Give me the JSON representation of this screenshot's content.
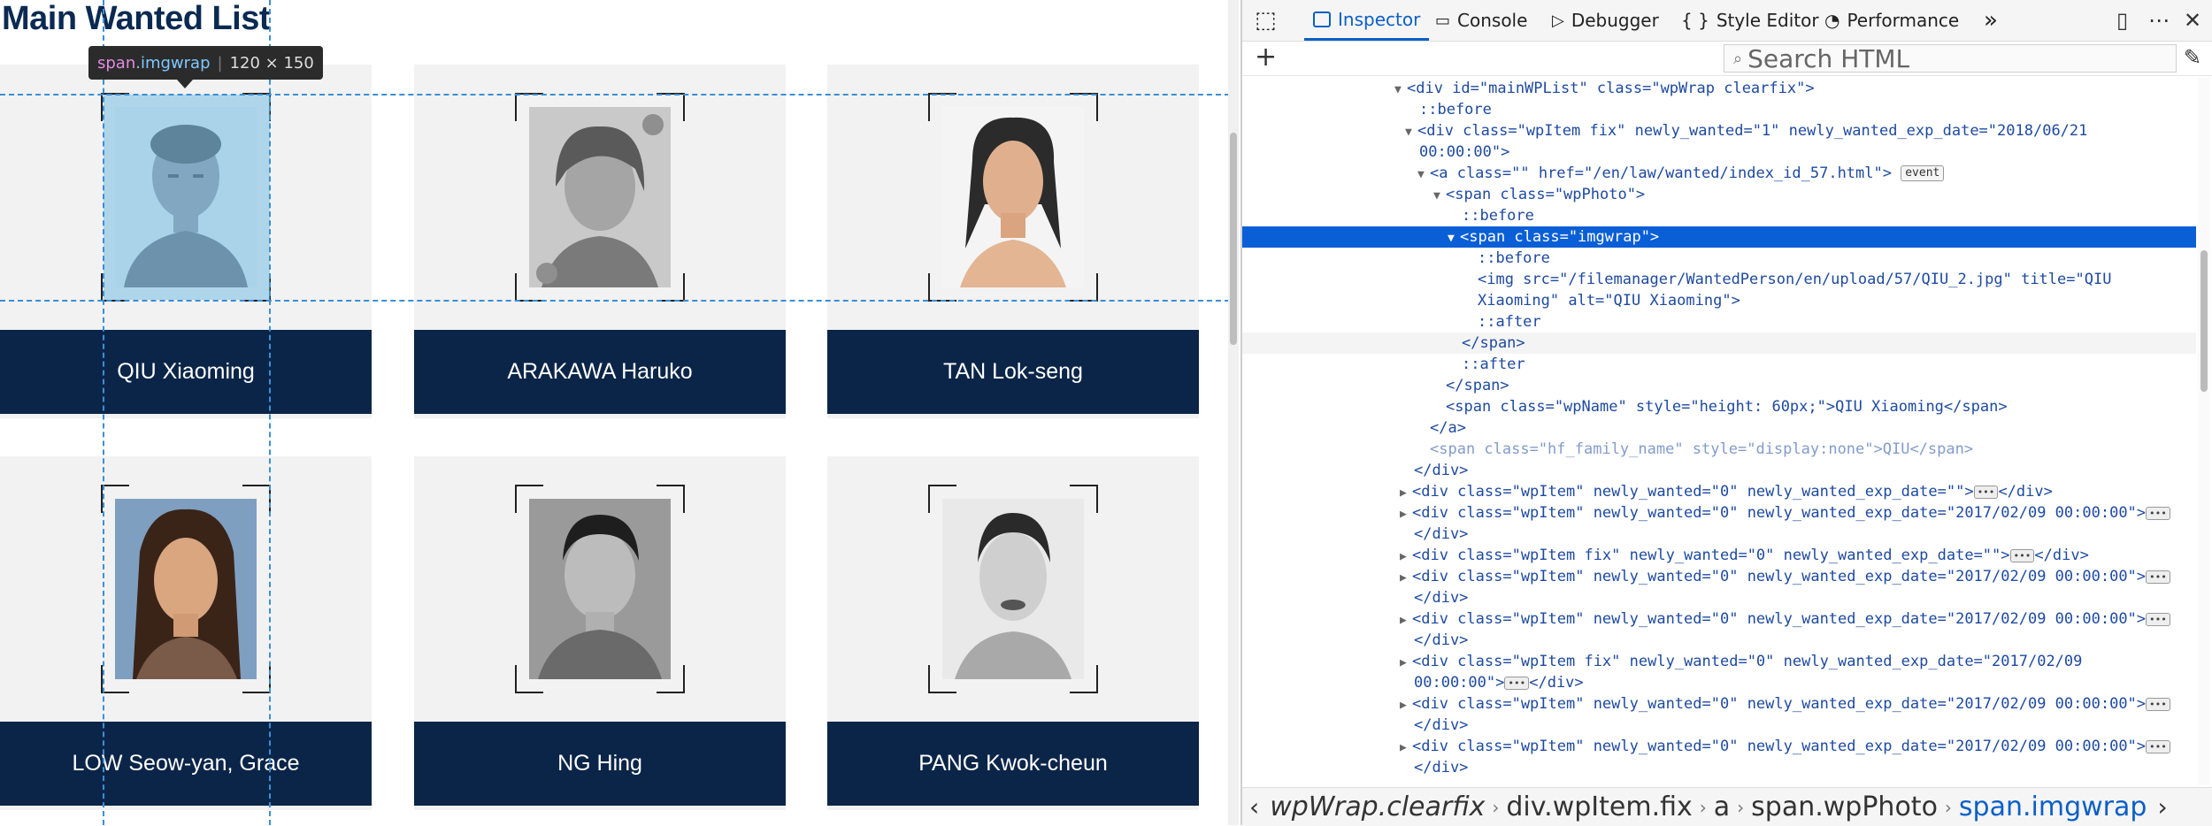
{
  "page": {
    "title": "Main Wanted List",
    "cards": [
      {
        "name": "QIU Xiaoming"
      },
      {
        "name": "ARAKAWA Haruko"
      },
      {
        "name": "TAN Lok-seng"
      },
      {
        "name": "LOW Seow-yan, Grace"
      },
      {
        "name": "NG Hing"
      },
      {
        "name": "PANG Kwok-cheun"
      }
    ],
    "tooltip": {
      "tag": "span",
      "cls": ".imgwrap",
      "size": "120 × 150"
    }
  },
  "devtools": {
    "tabs": [
      "Inspector",
      "Console",
      "Debugger",
      "Style Editor",
      "Performance"
    ],
    "overflow": "»",
    "search_placeholder": "Search HTML",
    "breadcrumbs": [
      "wpWrap.clearfix",
      "div.wpItem.fix",
      "a",
      "span.wpPhoto",
      "span.imgwrap"
    ]
  },
  "tree": [
    {
      "text": "<div id=\"mainWPList\" class=\"wpWrap clearfix\">"
    },
    {
      "text": "::before"
    },
    {
      "text": "<div class=\"wpItem fix\" newly_wanted=\"1\" newly_wanted_exp_date=\"2018/06/21"
    },
    {
      "text": "00:00:00\">"
    },
    {
      "text": "<a class=\"\" href=\"/en/law/wanted/index_id_57.html\">",
      "badge": "event"
    },
    {
      "text": "<span class=\"wpPhoto\">"
    },
    {
      "text": "::before"
    },
    {
      "text": "<span class=\"imgwrap\">"
    },
    {
      "text": "::before"
    },
    {
      "text": "<img src=\"/filemanager/WantedPerson/en/upload/57/QIU_2.jpg\" title=\"QIU"
    },
    {
      "text": "Xiaoming\" alt=\"QIU Xiaoming\">"
    },
    {
      "text": "::after"
    },
    {
      "text": "</span>"
    },
    {
      "text": "::after"
    },
    {
      "text": "</span>"
    },
    {
      "text": "<span class=\"wpName\" style=\"height: 60px;\">QIU Xiaoming</span>"
    },
    {
      "text": "</a>"
    },
    {
      "text": "<span class=\"hf_family_name\" style=\"display:none\">QIU</span>"
    },
    {
      "text": "</div>"
    },
    {
      "text": "<div class=\"wpItem\" newly_wanted=\"0\" newly_wanted_exp_date=\"\">",
      "tail": "</div>"
    },
    {
      "text": "<div class=\"wpItem\" newly_wanted=\"0\" newly_wanted_exp_date=\"2017/02/09 00:00:00\">"
    },
    {
      "text": "</div>"
    },
    {
      "text": "<div class=\"wpItem fix\" newly_wanted=\"0\" newly_wanted_exp_date=\"\">",
      "tail": "</div>"
    },
    {
      "text": "<div class=\"wpItem\" newly_wanted=\"0\" newly_wanted_exp_date=\"2017/02/09 00:00:00\">"
    },
    {
      "text": "</div>"
    },
    {
      "text": "<div class=\"wpItem\" newly_wanted=\"0\" newly_wanted_exp_date=\"2017/02/09 00:00:00\">"
    },
    {
      "text": "</div>"
    },
    {
      "text": "<div class=\"wpItem fix\" newly_wanted=\"0\" newly_wanted_exp_date=\"2017/02/09"
    },
    {
      "text": "00:00:00\">",
      "tail": "</div>"
    },
    {
      "text": "<div class=\"wpItem\" newly_wanted=\"0\" newly_wanted_exp_date=\"2017/02/09 00:00:00\">"
    },
    {
      "text": "</div>"
    },
    {
      "text": "<div class=\"wpItem\" newly_wanted=\"0\" newly_wanted_exp_date=\"2017/02/09 00:00:00\">"
    },
    {
      "text": "</div>"
    }
  ]
}
